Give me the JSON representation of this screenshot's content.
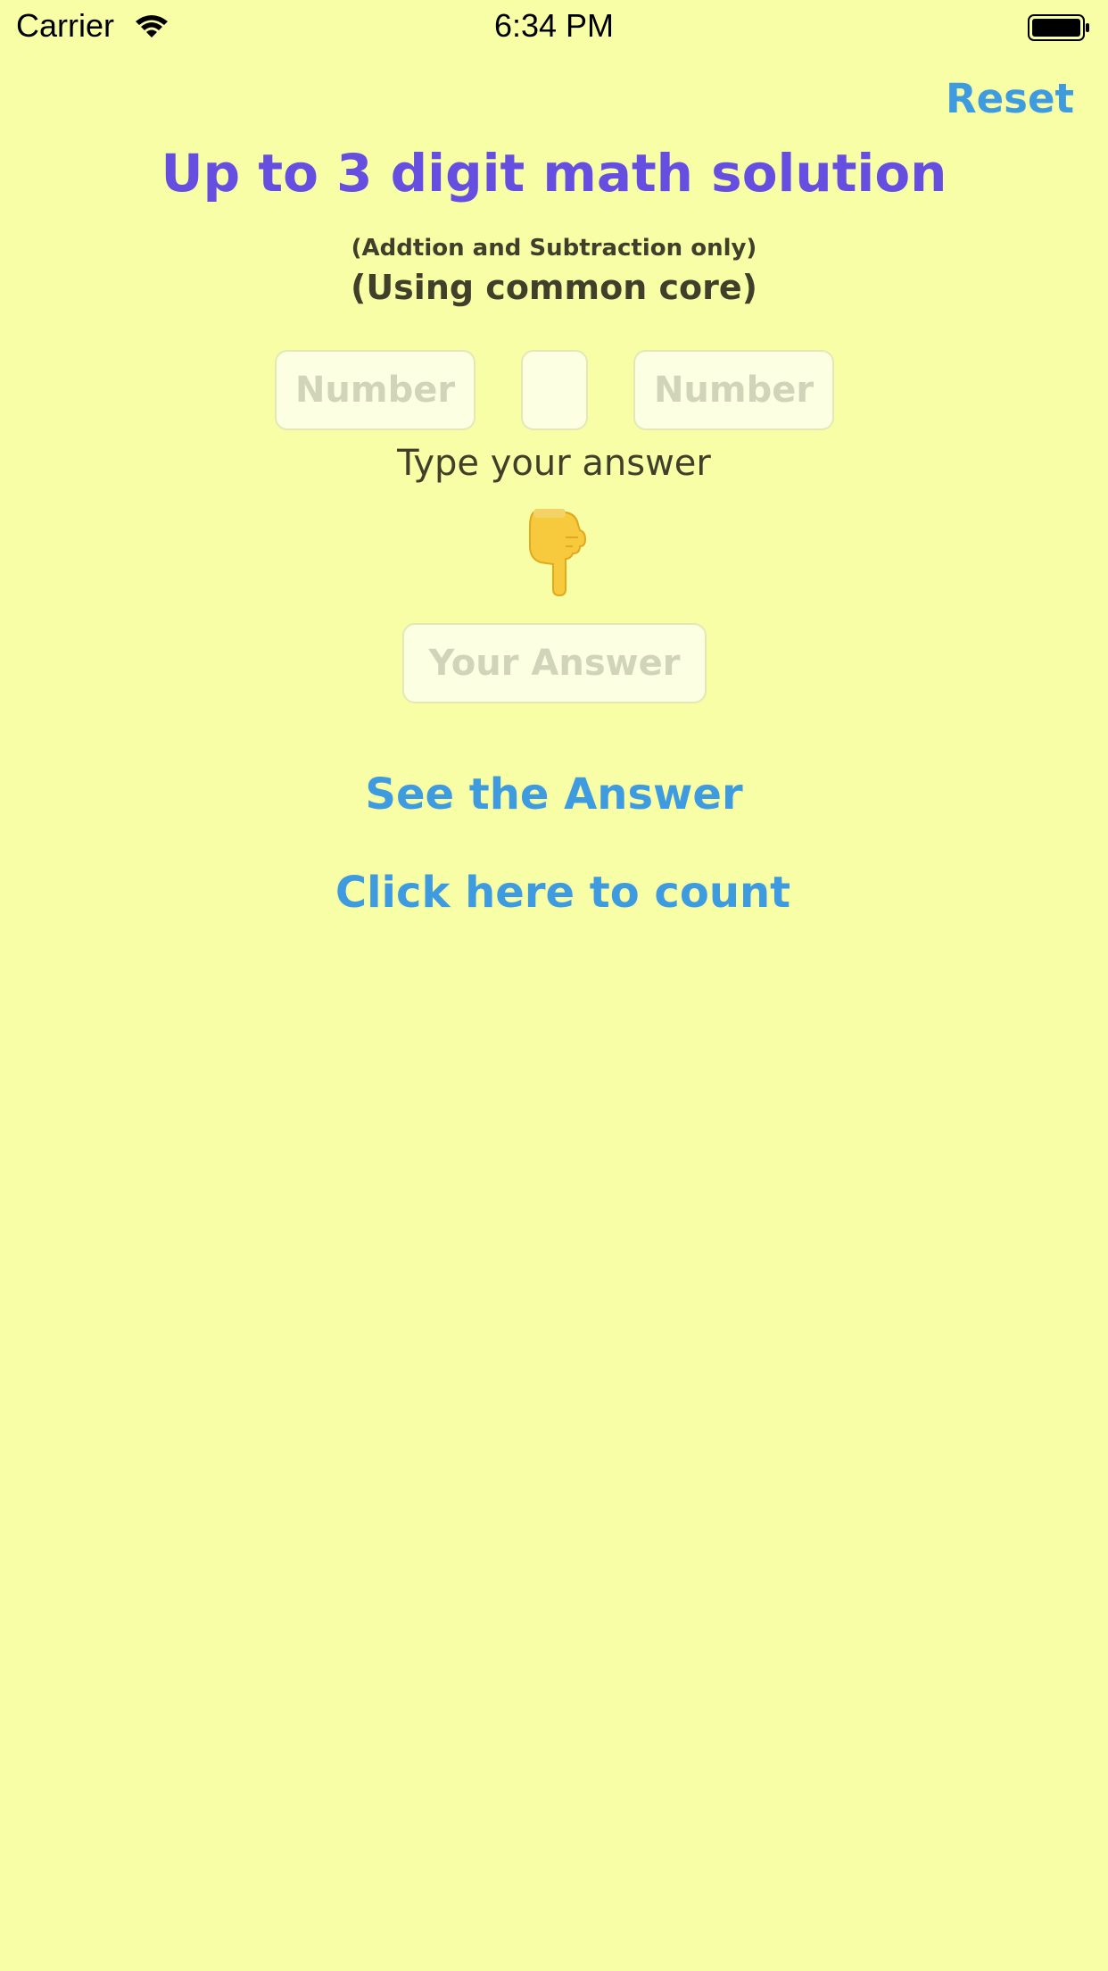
{
  "status_bar": {
    "carrier": "Carrier",
    "time": "6:34 PM"
  },
  "header": {
    "reset_label": "Reset",
    "title": "Up to 3 digit math solution",
    "note": "(Addtion and Subtraction only)",
    "method": "(Using common core)"
  },
  "inputs": {
    "first_number": {
      "value": "",
      "placeholder": "Number"
    },
    "operator": {
      "value": "",
      "placeholder": ""
    },
    "second_number": {
      "value": "",
      "placeholder": "Number"
    }
  },
  "prompt": {
    "instruction": "Type your answer",
    "pointer": "backhand-index-pointing-down"
  },
  "answer": {
    "value": "",
    "placeholder": "Your Answer"
  },
  "actions": {
    "see_answer_label": "See the Answer",
    "count_label": "Click here to count"
  },
  "colors": {
    "background": "#f8fea6",
    "title": "#654ee0",
    "link": "#3f9be0",
    "text": "#3f3f2a"
  }
}
